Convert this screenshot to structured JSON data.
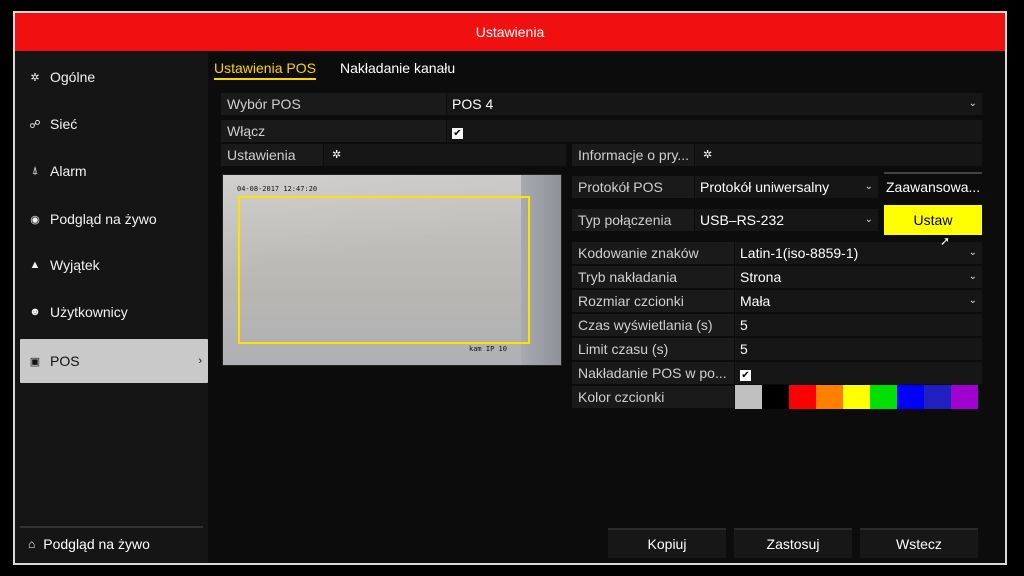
{
  "window": {
    "title": "Ustawienia"
  },
  "sidebar": {
    "items": [
      {
        "label": "Ogólne",
        "icon": "gear-icon",
        "glyph": "✲"
      },
      {
        "label": "Sieć",
        "icon": "network-icon",
        "glyph": "☍"
      },
      {
        "label": "Alarm",
        "icon": "alarm-icon",
        "glyph": "⍋"
      },
      {
        "label": "Podgląd na żywo",
        "icon": "eye-icon",
        "glyph": "◉"
      },
      {
        "label": "Wyjątek",
        "icon": "warning-icon",
        "glyph": "▲"
      },
      {
        "label": "Użytkownicy",
        "icon": "users-icon",
        "glyph": "☻"
      },
      {
        "label": "POS",
        "icon": "pos-icon",
        "glyph": "▣",
        "active": true
      }
    ],
    "bottom": {
      "label": "Podgląd na żywo",
      "icon": "home-icon",
      "glyph": "⌂"
    }
  },
  "tabs": [
    {
      "label": "Ustawienia POS",
      "active": true
    },
    {
      "label": "Nakładanie kanału",
      "active": false
    }
  ],
  "form": {
    "wybor_pos": {
      "label": "Wybór POS",
      "value": "POS 4"
    },
    "wlacz": {
      "label": "Włącz",
      "checked": true
    },
    "ustawienia": {
      "label": "Ustawienia"
    },
    "informacje": {
      "label": "Informacje o pry..."
    },
    "protokol": {
      "label": "Protokół POS",
      "value": "Protokół uniwersalny",
      "advanced": "Zaawansowa..."
    },
    "typ": {
      "label": "Typ połączenia",
      "value": "USB–RS-232",
      "button": "Ustaw"
    },
    "kodowanie": {
      "label": "Kodowanie znaków",
      "value": "Latin-1(iso-8859-1)"
    },
    "tryb": {
      "label": "Tryb nakładania",
      "value": "Strona"
    },
    "rozmiar": {
      "label": "Rozmiar czcionki",
      "value": "Mała"
    },
    "czas": {
      "label": "Czas wyświetlania (s)",
      "value": "5"
    },
    "limit": {
      "label": "Limit czasu (s)",
      "value": "5"
    },
    "nakladanie": {
      "label": "Nakładanie POS w po...",
      "checked": true
    },
    "kolor": {
      "label": "Kolor czcionki"
    }
  },
  "preview": {
    "timestamp": "04-08-2017 12:47:20",
    "camera": "kam IP 10"
  },
  "colors": {
    "swatches": [
      "#c0c0c0",
      "#000000",
      "#ff0000",
      "#ff7f00",
      "#ffff00",
      "#00e000",
      "#0000ff",
      "#2020c0",
      "#a000d0"
    ],
    "accent": "#ffd400",
    "titlebar": "#f01010"
  },
  "footer": {
    "copy": "Kopiuj",
    "apply": "Zastosuj",
    "back": "Wstecz"
  }
}
